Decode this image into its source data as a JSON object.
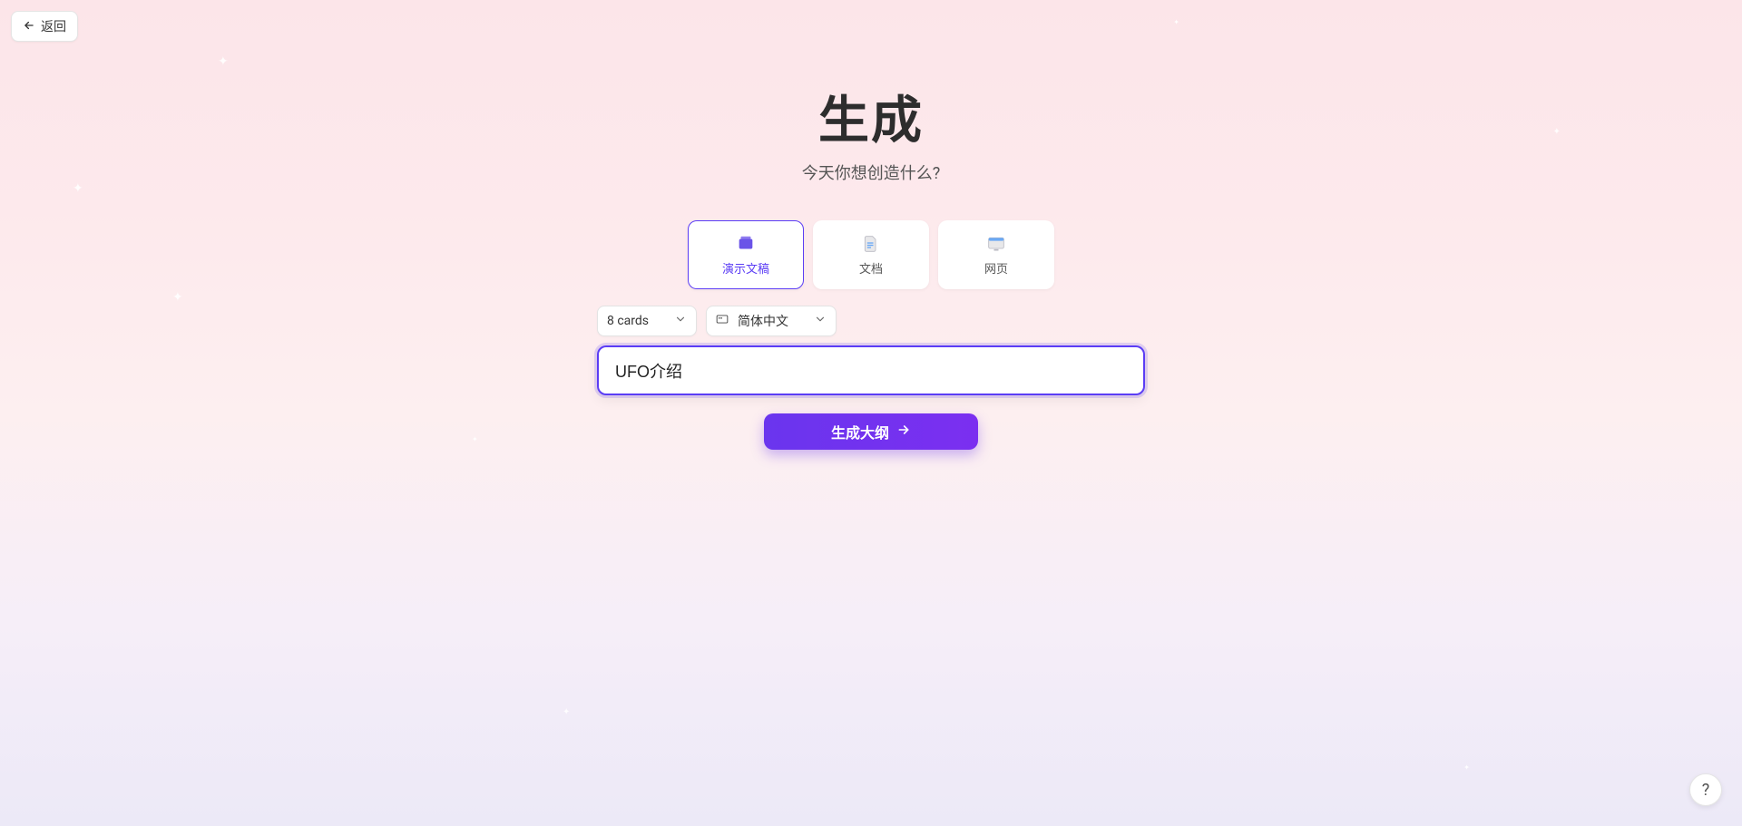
{
  "back": {
    "label": "返回"
  },
  "hero": {
    "title": "生成",
    "subtitle": "今天你想创造什么?"
  },
  "types": {
    "presentation": "演示文稿",
    "document": "文档",
    "webpage": "网页"
  },
  "options": {
    "cards": "8 cards",
    "language": "简体中文"
  },
  "prompt": {
    "value": "UFO介绍"
  },
  "actions": {
    "generate": "生成大纲"
  },
  "help": {
    "label": "?"
  }
}
